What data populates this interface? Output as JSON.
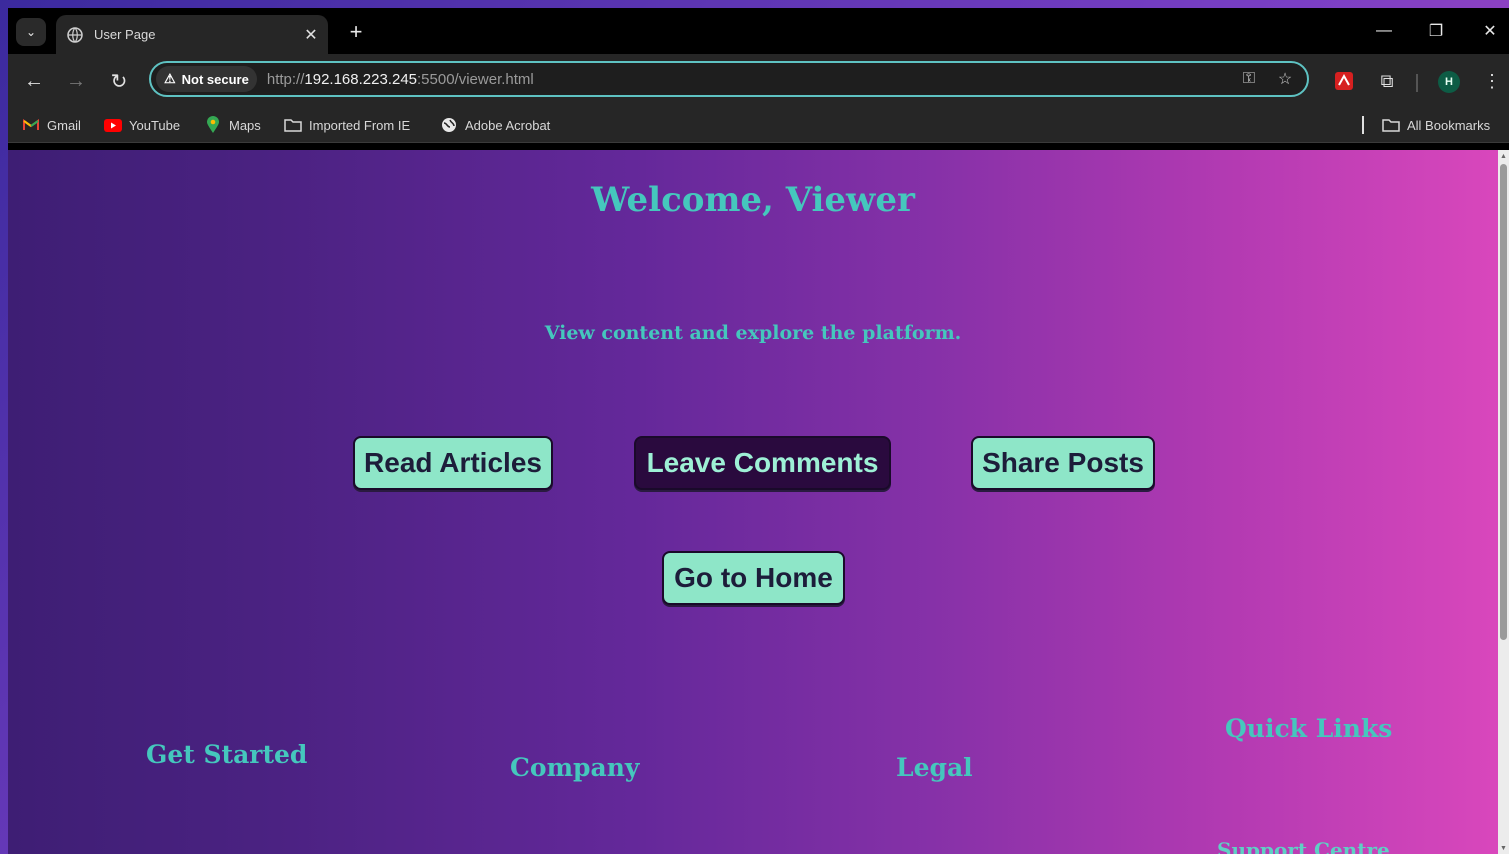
{
  "browser": {
    "tab_title": "User Page",
    "url_scheme": "http://",
    "url_host": "192.168.223.245",
    "url_path": ":5500/viewer.html",
    "security_chip": "Not secure",
    "avatar_letter": "H",
    "bookmarks": [
      "Gmail",
      "YouTube",
      "Maps",
      "Imported From IE",
      "Adobe Acrobat"
    ],
    "all_bookmarks": "All Bookmarks"
  },
  "page": {
    "heading": "Welcome, Viewer",
    "subtitle": "View content and explore the platform.",
    "buttons": {
      "read_articles": "Read Articles",
      "leave_comments": "Leave Comments",
      "share_posts": "Share Posts",
      "go_home": "Go to Home"
    },
    "footer": {
      "get_started": "Get Started",
      "company": "Company",
      "legal": "Legal",
      "quick_links": "Quick Links",
      "support_centre": "Support Centre"
    }
  },
  "colors": {
    "accent_teal": "#45c7bd",
    "button_bg": "#8ee6c8",
    "button_active_bg": "#2a0a3e",
    "omnibox_border": "#5ec2c2"
  }
}
